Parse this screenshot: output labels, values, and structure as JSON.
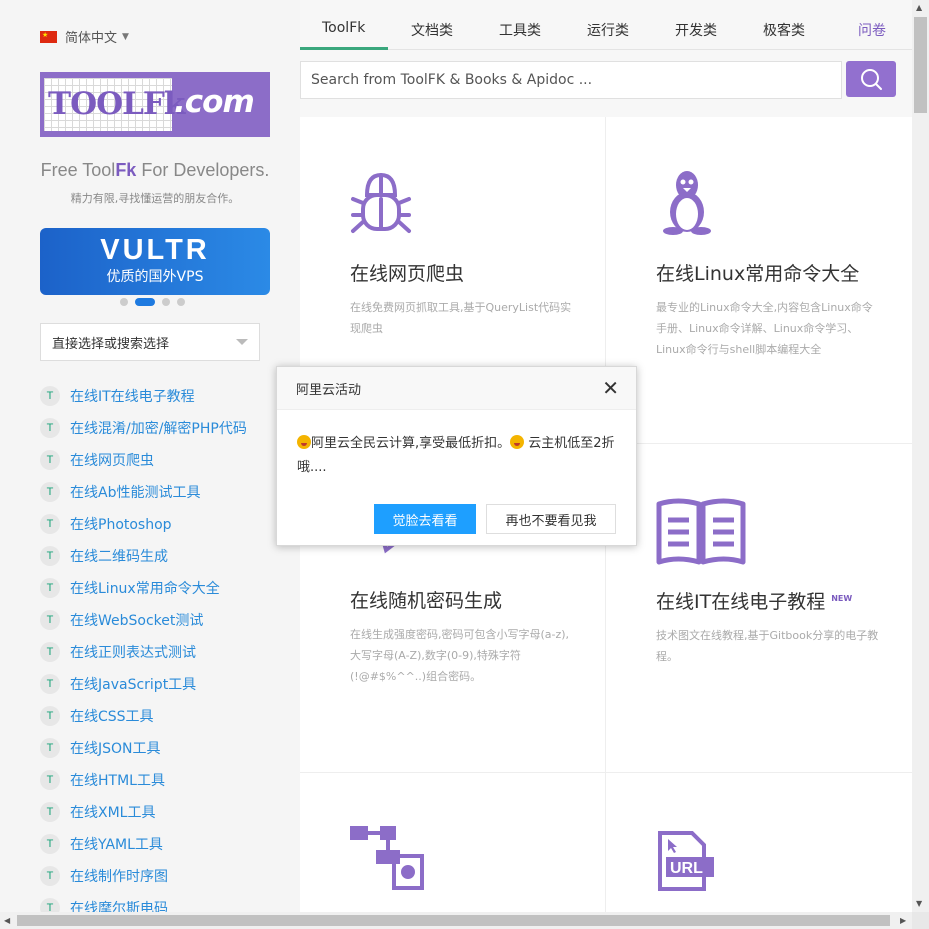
{
  "language": {
    "label": "简体中文"
  },
  "logo": {
    "left_text": "TOOLFk",
    "right_text": ".com"
  },
  "tagline": {
    "pre": "Free Tool",
    "brand": "Fk",
    "post": " For Developers.",
    "sub": "精力有限,寻找懂运营的朋友合作。"
  },
  "ad": {
    "brand": "VULTR",
    "sub": "优质的国外VPS"
  },
  "select": {
    "placeholder": "直接选择或搜索选择"
  },
  "tools": [
    {
      "icon": "T",
      "label": "在线IT在线电子教程"
    },
    {
      "icon": "T",
      "label": "在线混淆/加密/解密PHP代码"
    },
    {
      "icon": "T",
      "label": "在线网页爬虫"
    },
    {
      "icon": "T",
      "label": "在线Ab性能测试工具"
    },
    {
      "icon": "T",
      "label": "在线Photoshop"
    },
    {
      "icon": "T",
      "label": "在线二维码生成"
    },
    {
      "icon": "T",
      "label": "在线Linux常用命令大全"
    },
    {
      "icon": "T",
      "label": "在线WebSocket测试"
    },
    {
      "icon": "T",
      "label": "在线正则表达式测试"
    },
    {
      "icon": "T",
      "label": "在线JavaScript工具"
    },
    {
      "icon": "T",
      "label": "在线CSS工具"
    },
    {
      "icon": "T",
      "label": "在线JSON工具"
    },
    {
      "icon": "T",
      "label": "在线HTML工具"
    },
    {
      "icon": "T",
      "label": "在线XML工具"
    },
    {
      "icon": "T",
      "label": "在线YAML工具"
    },
    {
      "icon": "T",
      "label": "在线制作时序图"
    },
    {
      "icon": "T",
      "label": "在线摩尔斯电码"
    }
  ],
  "nav": {
    "tabs": [
      "ToolFk",
      "文档类",
      "工具类",
      "运行类",
      "开发类",
      "极客类"
    ],
    "ask": "问卷"
  },
  "search": {
    "placeholder": "Search from ToolFK & Books & Apidoc ..."
  },
  "cards": [
    {
      "icon": "bug-icon",
      "title": "在线网页爬虫",
      "desc": "在线免费网页抓取工具,基于QueryList代码实现爬虫"
    },
    {
      "icon": "linux-penguin-icon",
      "title": "在线Linux常用命令大全",
      "desc": "最专业的Linux命令大全,内容包含Linux命令手册、Linux命令详解、Linux命令学习、Linux命令行与shell脚本编程大全"
    },
    {
      "icon": "key-icon",
      "title": "在线随机密码生成",
      "desc": "在线生成强度密码,密码可包含小写字母(a-z),大写字母(A-Z),数字(0-9),特殊字符(!@#$%^^..)组合密码。"
    },
    {
      "icon": "book-icon",
      "title": "在线IT在线电子教程",
      "badge": "NEW",
      "desc": "技术图文在线教程,基于Gitbook分享的电子教程。"
    },
    {
      "icon": "flowchart-icon",
      "title": "",
      "desc": ""
    },
    {
      "icon": "url-file-icon",
      "title": "",
      "desc": ""
    }
  ],
  "dialog": {
    "title": "阿里云活动",
    "body_part1": "阿里云全民云计算,享受最低折扣。",
    "body_part2": " 云主机低至2折哦....",
    "primary": "觉脸去看看",
    "secondary": "再也不要看见我"
  },
  "colors": {
    "accent": "#7b5bbf",
    "link": "#2a8bd9",
    "nav_underline": "#3aa77d",
    "primary_button": "#1e9fff"
  }
}
